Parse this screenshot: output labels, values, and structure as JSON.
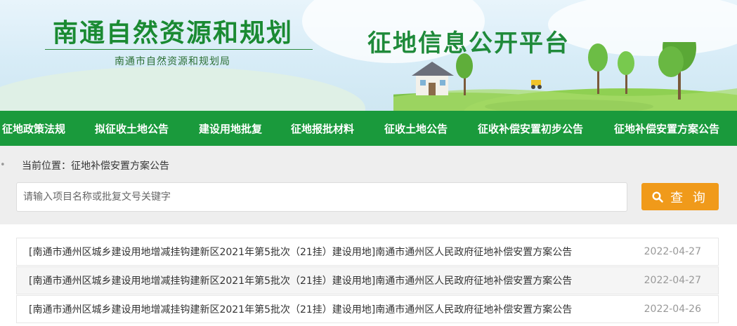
{
  "header": {
    "brand_title": "南通自然资源和规划",
    "brand_subtitle": "南通市自然资源和规划局",
    "platform_title": "征地信息公开平台"
  },
  "nav": {
    "items": [
      {
        "label": "征地政策法规"
      },
      {
        "label": "拟征收土地公告"
      },
      {
        "label": "建设用地批复"
      },
      {
        "label": "征地报批材料"
      },
      {
        "label": "征收土地公告"
      },
      {
        "label": "征收补偿安置初步公告"
      },
      {
        "label": "征地补偿安置方案公告"
      }
    ]
  },
  "breadcrumb": {
    "prefix": "当前位置：",
    "current": "征地补偿安置方案公告"
  },
  "search": {
    "placeholder": "请输入项目名称或批复文号关键字",
    "button_label": "查 询"
  },
  "list": {
    "items": [
      {
        "title": "[南通市通州区城乡建设用地增减挂钩建新区2021年第5批次（21挂）建设用地]南通市通州区人民政府征地补偿安置方案公告",
        "date": "2022-04-27"
      },
      {
        "title": "[南通市通州区城乡建设用地增减挂钩建新区2021年第5批次（21挂）建设用地]南通市通州区人民政府征地补偿安置方案公告",
        "date": "2022-04-27"
      },
      {
        "title": "[南通市通州区城乡建设用地增减挂钩建新区2021年第5批次（21挂）建设用地]南通市通州区人民政府征地补偿安置方案公告",
        "date": "2022-04-26"
      }
    ]
  },
  "colors": {
    "nav_bg": "#1a9a3c",
    "brand_green": "#1a8a32",
    "search_button": "#f09a1a"
  }
}
